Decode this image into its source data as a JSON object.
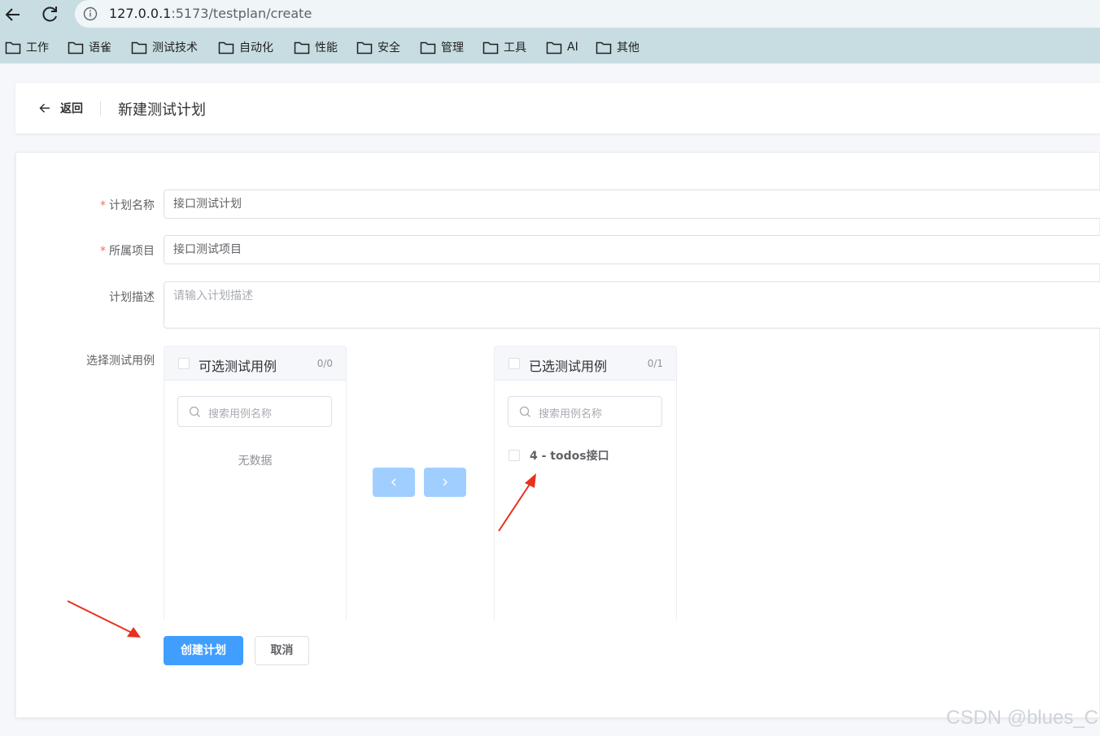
{
  "browser": {
    "url_host": "127.0.0.1",
    "url_path": ":5173/testplan/create"
  },
  "bookmarks": [
    "工作",
    "语雀",
    "测试技术",
    "自动化",
    "性能",
    "安全",
    "管理",
    "工具",
    "AI",
    "其他"
  ],
  "header": {
    "back_label": "返回",
    "title": "新建测试计划"
  },
  "form": {
    "required_mark": "*",
    "plan_name_label": "计划名称",
    "plan_name_value": "接口测试计划",
    "project_label": "所属项目",
    "project_value": "接口测试项目",
    "description_label": "计划描述",
    "description_placeholder": "请输入计划描述",
    "cases_label": "选择测试用例"
  },
  "transfer": {
    "left": {
      "title": "可选测试用例",
      "count": "0/0",
      "search_placeholder": "搜索用例名称",
      "empty_text": "无数据"
    },
    "right": {
      "title": "已选测试用例",
      "count": "0/1",
      "search_placeholder": "搜索用例名称",
      "items": [
        "4 - todos接口"
      ]
    }
  },
  "actions": {
    "create_label": "创建计划",
    "cancel_label": "取消"
  },
  "watermark": "CSDN @blues_C",
  "colors": {
    "primary": "#409eff",
    "disabled_primary": "#a0cfff",
    "required": "#f56c6c",
    "annotation_arrow": "#e8321f",
    "browser_chrome": "#c8dde2"
  }
}
